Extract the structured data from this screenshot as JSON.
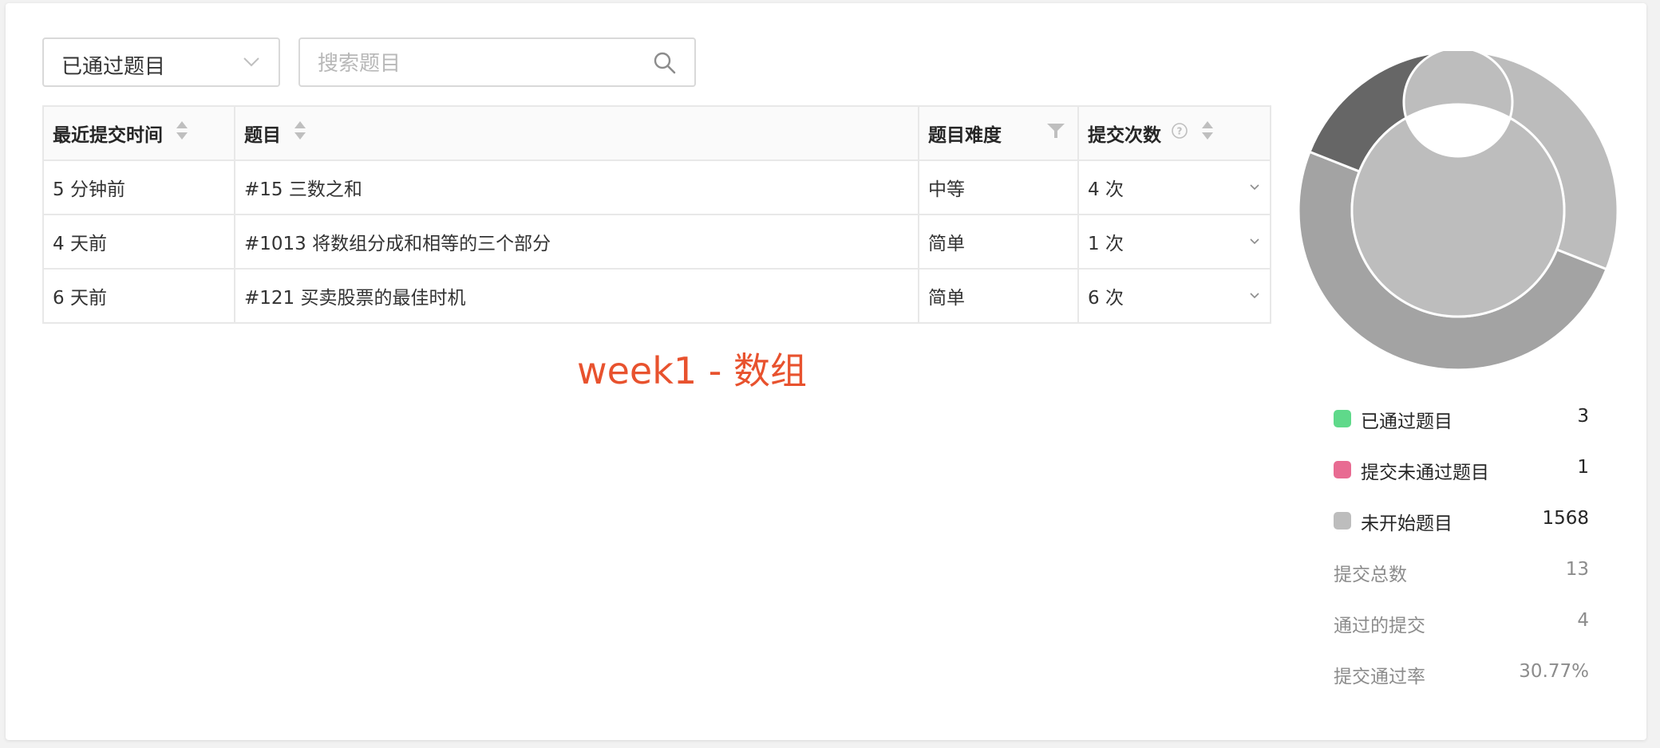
{
  "filter_select": {
    "value": "已通过题目"
  },
  "search": {
    "placeholder": "搜索题目"
  },
  "table": {
    "headers": [
      "最近提交时间",
      "题目",
      "题目难度",
      "提交次数"
    ],
    "rows": [
      {
        "time": "5 分钟前",
        "title": "#15 三数之和",
        "difficulty": "中等",
        "difficulty_level": "medium",
        "count": "4 次"
      },
      {
        "time": "4 天前",
        "title": "#1013 将数组分成和相等的三个部分",
        "difficulty": "简单",
        "difficulty_level": "easy",
        "count": "1 次"
      },
      {
        "time": "6 天前",
        "title": "#121 买卖股票的最佳时机",
        "difficulty": "简单",
        "difficulty_level": "easy",
        "count": "6 次"
      }
    ]
  },
  "annotation": "week1 - 数组",
  "legend": [
    {
      "label": "已通过题目",
      "value": "3",
      "color": "#5fd98a"
    },
    {
      "label": "提交未通过题目",
      "value": "1",
      "color": "#e86b92"
    },
    {
      "label": "未开始题目",
      "value": "1568",
      "color": "#bdbdbd"
    }
  ],
  "stats": [
    {
      "label": "提交总数",
      "value": "13"
    },
    {
      "label": "通过的提交",
      "value": "4"
    },
    {
      "label": "提交通过率",
      "value": "30.77%"
    }
  ],
  "chart_data": {
    "type": "pie",
    "style": "nested-donut",
    "rings": [
      {
        "ring": "outer",
        "slices": [
          {
            "fraction": 0.31,
            "color": "#bcbcbc"
          },
          {
            "fraction": 0.5,
            "color": "#a3a3a3"
          },
          {
            "fraction": 0.19,
            "color": "#666666"
          }
        ]
      },
      {
        "ring": "inner",
        "slices": [
          {
            "fraction": 1.0,
            "color": "#bdbdbd"
          }
        ]
      }
    ]
  }
}
